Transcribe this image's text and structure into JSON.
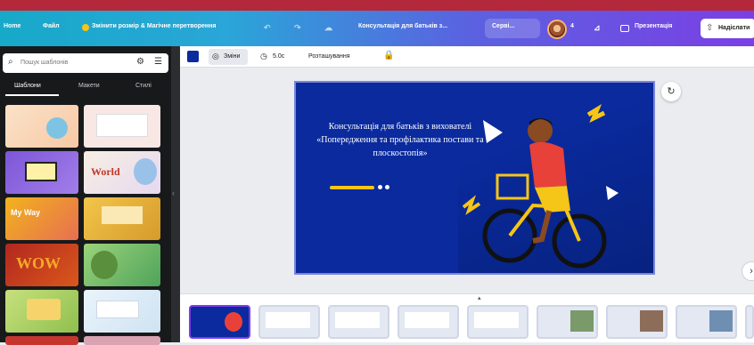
{
  "header": {
    "home_label": "Home",
    "file_label": "Файл",
    "resize_label": "Змінити розмір & Магічне перетворення",
    "doc_title": "Консультація для батьків з...",
    "share_label": "Серві...",
    "present_label": "Презентація",
    "share_button_label": "Надіслати",
    "avatar_badge": "4"
  },
  "sidebar": {
    "search_placeholder": "Пошук шаблонів",
    "tabs": [
      "Шаблони",
      "Макети",
      "Стилі"
    ],
    "active_tab": 0
  },
  "toolbar": {
    "color_swatch": "#0a2a9e",
    "edit_label": "Зміни",
    "duration_label": "5.0с",
    "position_label": "Розташування"
  },
  "slide": {
    "title_text": "Консультація для батьків з вихователі «Попередження та профілактика постави та плоскостопія»",
    "bg_color": "#0a2a9e",
    "accent_color": "#f5c518"
  },
  "thumbnails": {
    "left_texts": [
      "World",
      "My Way",
      "WOW"
    ],
    "filmstrip_count": 9
  }
}
